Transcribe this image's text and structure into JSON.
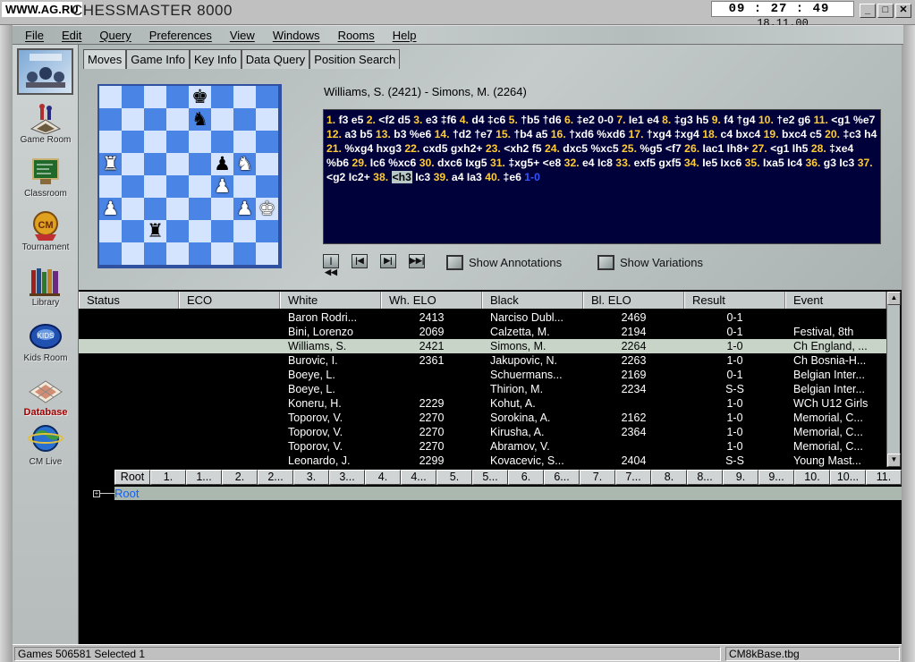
{
  "titlebar": {
    "site": "WWW.AG.RU",
    "title": "CHESSMASTER 8000",
    "clock_time": "09 : 27 : 49",
    "clock_date": "18.11.00",
    "min_glyph": "_",
    "max_glyph": "□",
    "close_glyph": "✕"
  },
  "menu": [
    "File",
    "Edit",
    "Query",
    "Preferences",
    "View",
    "Windows",
    "Rooms",
    "Help"
  ],
  "sidebar": [
    {
      "label": "Game Room",
      "icon": "game-room-icon"
    },
    {
      "label": "Classroom",
      "icon": "classroom-icon"
    },
    {
      "label": "Tournament",
      "icon": "tournament-icon"
    },
    {
      "label": "Library",
      "icon": "library-icon"
    },
    {
      "label": "Kids Room",
      "icon": "kids-room-icon"
    },
    {
      "label": "Database",
      "icon": "database-icon"
    },
    {
      "label": "CM Live",
      "icon": "cm-live-icon"
    }
  ],
  "tabs": [
    "Moves",
    "Game Info",
    "Key Info",
    "Data Query",
    "Position Search"
  ],
  "board": {
    "rows": [
      [
        "",
        "",
        "",
        "",
        "bk",
        "",
        "",
        ""
      ],
      [
        "",
        "",
        "",
        "",
        "bn",
        "",
        "",
        ""
      ],
      [
        "",
        "",
        "",
        "",
        "",
        "",
        "",
        ""
      ],
      [
        "wr",
        "",
        "",
        "",
        "",
        "bp",
        "wn",
        ""
      ],
      [
        "",
        "",
        "",
        "",
        "",
        "wp",
        "",
        ""
      ],
      [
        "wp",
        "",
        "",
        "",
        "",
        "",
        "wp",
        "wk"
      ],
      [
        "",
        "",
        "br",
        "",
        "",
        "",
        "",
        ""
      ],
      [
        "",
        "",
        "",
        "",
        "",
        "",
        "",
        ""
      ]
    ],
    "light_color": "#d4e4ff",
    "dark_color": "#4a84e4"
  },
  "game": {
    "header": "Williams, S. (2421) - Simons, M. (2264)",
    "moves": [
      [
        "1.",
        "f3 e5"
      ],
      [
        "2.",
        "<f2 d5"
      ],
      [
        "3.",
        "e3 ‡f6"
      ],
      [
        "4.",
        "d4 ‡c6"
      ],
      [
        "5.",
        "†b5 †d6"
      ],
      [
        "6.",
        "‡e2 0-0"
      ],
      [
        "7.",
        "Ie1 e4"
      ],
      [
        "8.",
        "‡g3 h5"
      ],
      [
        "9.",
        "f4 †g4"
      ],
      [
        "10.",
        "†e2 g6"
      ],
      [
        "11.",
        "<g1 %e7"
      ],
      [
        "12.",
        "a3 b5"
      ],
      [
        "13.",
        "b3 %e6"
      ],
      [
        "14.",
        "†d2 †e7"
      ],
      [
        "15.",
        "†b4 a5"
      ],
      [
        "16.",
        "†xd6 %xd6"
      ],
      [
        "17.",
        "†xg4 ‡xg4"
      ],
      [
        "18.",
        "c4 bxc4"
      ],
      [
        "19.",
        "bxc4 c5"
      ],
      [
        "20.",
        "‡c3 h4"
      ],
      [
        "21.",
        "%xg4 hxg3"
      ],
      [
        "22.",
        "cxd5 gxh2+"
      ],
      [
        "23.",
        "<xh2 f5"
      ],
      [
        "24.",
        "dxc5 %xc5"
      ],
      [
        "25.",
        "%g5 <f7"
      ],
      [
        "26.",
        "Iac1 Ih8+"
      ],
      [
        "27.",
        "<g1 Ih5"
      ],
      [
        "28.",
        "‡xe4 %b6"
      ],
      [
        "29.",
        "Ic6 %xc6"
      ],
      [
        "30.",
        "dxc6 Ixg5"
      ],
      [
        "31.",
        "‡xg5+ <e8"
      ],
      [
        "32.",
        "e4 Ic8"
      ],
      [
        "33.",
        "exf5 gxf5"
      ],
      [
        "34.",
        "Ie5 Ixc6"
      ],
      [
        "35.",
        "Ixa5 Ic4"
      ],
      [
        "36.",
        "g3 Ic3"
      ],
      [
        "37.",
        "<g2 Ic2+"
      ],
      [
        "38.",
        "<h3|Ic3"
      ],
      [
        "39.",
        "a4 Ia3"
      ],
      [
        "40.",
        "‡e6"
      ]
    ],
    "result": "1-0"
  },
  "nav": {
    "first": "|◀◀",
    "prev": "|◀",
    "next": "▶|",
    "last": "▶▶|",
    "show_annotations": "Show Annotations",
    "show_variations": "Show Variations"
  },
  "list": {
    "columns": [
      "Status",
      "ECO",
      "White",
      "Wh. ELO",
      "Black",
      "Bl. ELO",
      "Result",
      "Event"
    ],
    "rows": [
      [
        "",
        "",
        "Baron Rodri...",
        "2413",
        "Narciso Dubl...",
        "2469",
        "0-1",
        ""
      ],
      [
        "",
        "",
        "Bini, Lorenzo",
        "2069",
        "Calzetta, M.",
        "2194",
        "0-1",
        "Festival, 8th"
      ],
      [
        "",
        "",
        "Williams, S.",
        "2421",
        "Simons, M.",
        "2264",
        "1-0",
        "Ch England, ..."
      ],
      [
        "",
        "",
        "Burovic, I.",
        "2361",
        "Jakupovic, N.",
        "2263",
        "1-0",
        "Ch Bosnia-H..."
      ],
      [
        "",
        "",
        "Boeye, L.",
        "",
        "Schuermans...",
        "2169",
        "0-1",
        "Belgian Inter..."
      ],
      [
        "",
        "",
        "Boeye, L.",
        "",
        "Thirion, M.",
        "2234",
        "S-S",
        "Belgian Inter..."
      ],
      [
        "",
        "",
        "Koneru, H.",
        "2229",
        "Kohut, A.",
        "",
        "1-0",
        "WCh U12 Girls"
      ],
      [
        "",
        "",
        "Toporov, V.",
        "2270",
        "Sorokina, A.",
        "2162",
        "1-0",
        "Memorial, C..."
      ],
      [
        "",
        "",
        "Toporov, V.",
        "2270",
        "Kirusha, A.",
        "2364",
        "1-0",
        "Memorial, C..."
      ],
      [
        "",
        "",
        "Toporov, V.",
        "2270",
        "Abramov, V.",
        "",
        "1-0",
        "Memorial, C..."
      ],
      [
        "",
        "",
        "Leonardo, J.",
        "2299",
        "Kovacevic, S...",
        "2404",
        "S-S",
        "Young Mast..."
      ]
    ],
    "selected_index": 2,
    "scroll_up": "▲",
    "scroll_down": "▼"
  },
  "tree": {
    "ply": [
      "Root",
      "1.",
      "1...",
      "2.",
      "2...",
      "3.",
      "3...",
      "4.",
      "4...",
      "5.",
      "5...",
      "6.",
      "6...",
      "7.",
      "7...",
      "8.",
      "8...",
      "9.",
      "9...",
      "10.",
      "10...",
      "11."
    ],
    "root_label": "Root",
    "expand": "+"
  },
  "status": {
    "left": "Games 506581 Selected 1",
    "right": "CM8kBase.tbg"
  }
}
